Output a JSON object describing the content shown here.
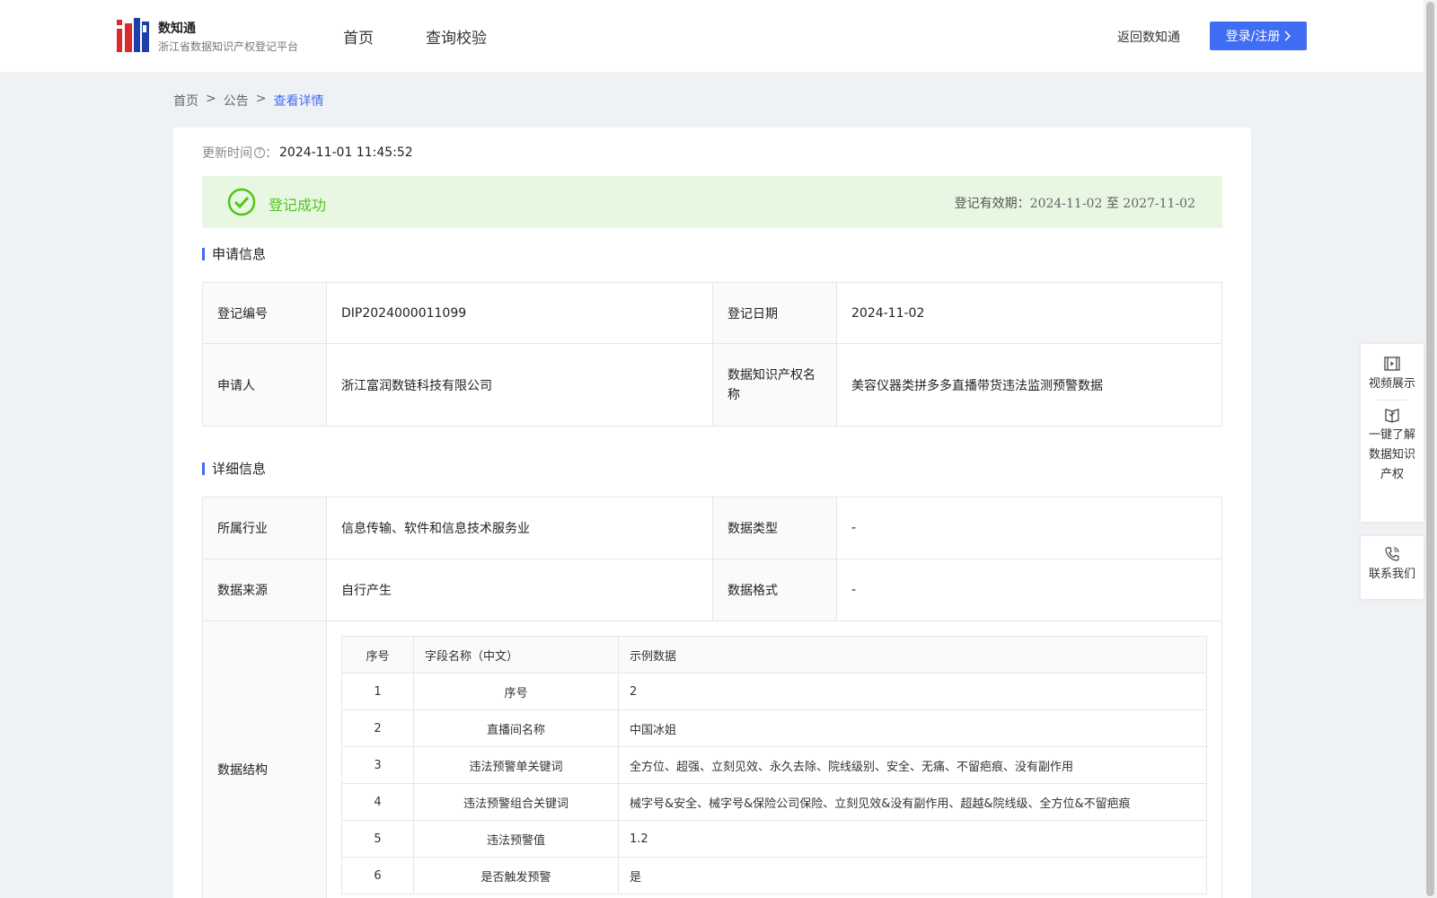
{
  "header": {
    "logo_title": "数知通",
    "logo_subtitle": "浙江省数据知识产权登记平台",
    "nav": [
      "首页",
      "查询校验"
    ],
    "back_link": "返回数知通",
    "login_label": "登录/注册",
    "accent_color": "#3f6df3"
  },
  "breadcrumb": {
    "items": [
      "首页",
      "公告",
      "查看详情"
    ],
    "separator": ">"
  },
  "detail": {
    "update_label": "更新时间",
    "update_sep": "：",
    "update_value": "2024-11-01 11:45:52",
    "status_text": "登记成功",
    "validity_label": "登记有效期：",
    "validity_start": "2024-11-02",
    "validity_to": "至",
    "validity_end": "2027-11-02",
    "status_color": "#52c41a"
  },
  "application": {
    "title": "申请信息",
    "reg_no_label": "登记编号",
    "reg_no": "DIP2024000011099",
    "reg_date_label": "登记日期",
    "reg_date": "2024-11-02",
    "applicant_label": "申请人",
    "applicant": "浙江富润数链科技有限公司",
    "name_label": "数据知识产权名称",
    "name": "美容仪器类拼多多直播带货违法监测预警数据"
  },
  "details": {
    "title": "详细信息",
    "industry_label": "所属行业",
    "industry": "信息传输、软件和信息技术服务业",
    "type_label": "数据类型",
    "type": "-",
    "source_label": "数据来源",
    "source": "自行产生",
    "format_label": "数据格式",
    "format": "-",
    "structure_label": "数据结构",
    "structure": {
      "headers": [
        "序号",
        "字段名称（中文）",
        "示例数据"
      ],
      "rows": [
        [
          "1",
          "序号",
          "2"
        ],
        [
          "2",
          "直播间名称",
          "中国冰姐"
        ],
        [
          "3",
          "违法预警单关键词",
          "全方位、超强、立刻见效、永久去除、院线级别、安全、无痛、不留疤痕、没有副作用"
        ],
        [
          "4",
          "违法预警组合关键词",
          "械字号&安全、械字号&保险公司保险、立刻见效&没有副作用、超越&院线级、全方位&不留疤痕"
        ],
        [
          "5",
          "违法预警值",
          "1.2"
        ],
        [
          "6",
          "是否触发预警",
          "是"
        ]
      ]
    }
  },
  "side_panel": {
    "video": "视频展示",
    "learn": [
      "一键了解",
      "数据知识",
      "产权"
    ],
    "contact": "联系我们"
  }
}
